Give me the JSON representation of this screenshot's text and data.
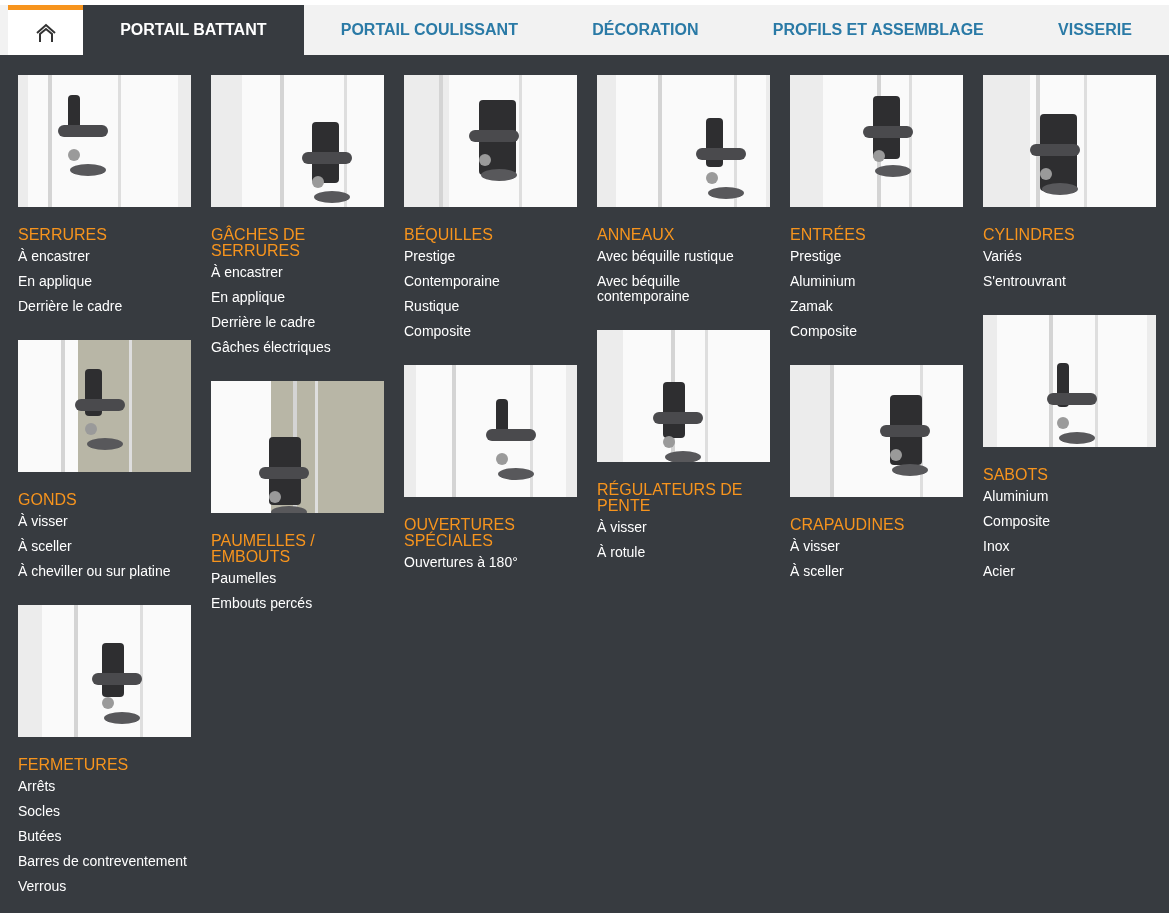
{
  "tabs": [
    {
      "kind": "home",
      "selected": false
    },
    {
      "kind": "text",
      "label": "PORTAIL BATTANT",
      "selected": true
    },
    {
      "kind": "text",
      "label": "PORTAIL COULISSANT",
      "selected": false
    },
    {
      "kind": "text",
      "label": "DÉCORATION",
      "selected": false
    },
    {
      "kind": "text",
      "label": "PROFILS ET ASSEMBLAGE",
      "selected": false
    },
    {
      "kind": "text",
      "label": "VISSERIE",
      "selected": false
    }
  ],
  "columns": [
    {
      "categories": [
        {
          "title": "SERRURES",
          "items": [
            "À encastrer",
            "En applique",
            "Derrière le cadre"
          ]
        },
        {
          "title": "GONDS",
          "items": [
            "À visser",
            "À sceller",
            "À cheviller ou sur platine"
          ]
        },
        {
          "title": "FERMETURES",
          "items": [
            "Arrêts",
            "Socles",
            "Butées",
            "Barres de contreventement",
            "Verrous"
          ]
        }
      ]
    },
    {
      "categories": [
        {
          "title": "GÂCHES DE SERRURES",
          "items": [
            "À encastrer",
            "En applique",
            "Derrière le cadre",
            "Gâches électriques"
          ]
        },
        {
          "title": "PAUMELLES / EMBOUTS",
          "items": [
            "Paumelles",
            "Embouts percés"
          ]
        }
      ]
    },
    {
      "categories": [
        {
          "title": "BÉQUILLES",
          "items": [
            "Prestige",
            "Contemporaine",
            "Rustique",
            "Composite"
          ]
        },
        {
          "title": "OUVERTURES SPÉCIALES",
          "items": [
            "Ouvertures à 180°"
          ]
        }
      ]
    },
    {
      "categories": [
        {
          "title": "ANNEAUX",
          "items": [
            "Avec béquille rustique",
            "Avec béquille contemporaine"
          ]
        },
        {
          "title": "RÉGULATEURS DE PENTE",
          "items": [
            "À visser",
            "À rotule"
          ]
        }
      ]
    },
    {
      "categories": [
        {
          "title": "ENTRÉES",
          "items": [
            "Prestige",
            "Aluminium",
            "Zamak",
            "Composite"
          ]
        },
        {
          "title": "CRAPAUDINES",
          "items": [
            "À visser",
            "À sceller"
          ]
        }
      ]
    },
    {
      "categories": [
        {
          "title": "CYLINDRES",
          "items": [
            "Variés",
            "S'entrouvrant"
          ]
        },
        {
          "title": "SABOTS",
          "items": [
            "Aluminium",
            "Composite",
            "Inox",
            "Acier"
          ]
        }
      ]
    }
  ]
}
